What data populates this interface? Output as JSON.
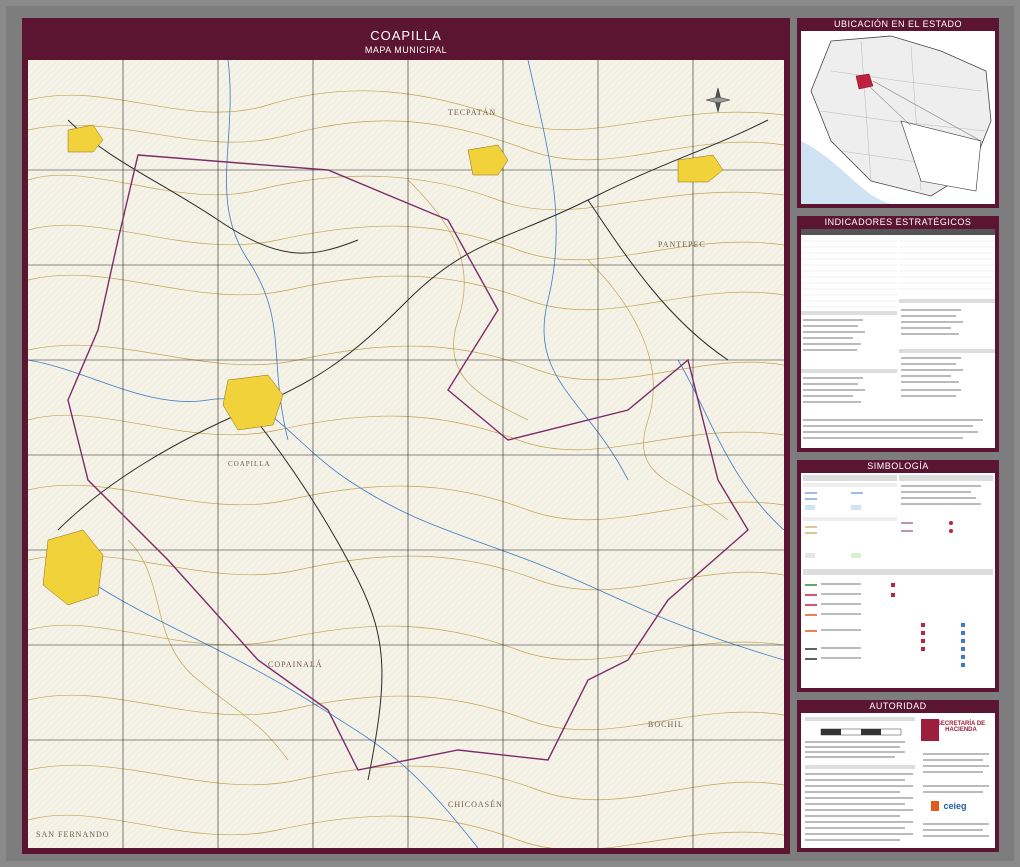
{
  "map": {
    "title": "COAPILLA",
    "subtitle": "MAPA MUNICIPAL",
    "places": [
      "COPAINALÁ",
      "BOCHIL",
      "TECPATÁN",
      "COAPILLA",
      "PANTEPEC",
      "SAN FERNANDO",
      "CHICOASÉN"
    ]
  },
  "panels": {
    "location": {
      "title": "UBICACIÓN EN EL ESTADO"
    },
    "indicators": {
      "title": "INDICADORES ESTRATÉGICOS"
    },
    "symbology": {
      "title": "SIMBOLOGÍA",
      "natural": "RASGOS NATURALES",
      "cultural": "RASGOS CULTURALES",
      "hydro": "HIDROGRAFÍA",
      "infra": "INFRAESTRUCTURA",
      "relief": "RELIEVE"
    },
    "authority": {
      "title": "AUTORIDAD",
      "params": "PARÁMETROS CARTOGRÁFICOS",
      "sources": "FUENTES DE INFORMACIÓN",
      "brand_top": "SECRETARÍA DE HACIENDA",
      "brand_bottom": "ceieg"
    }
  },
  "colors": {
    "frame": "#5b1530",
    "contour": "#b8912f",
    "river": "#3d7ac8",
    "road": "#2a2a2a",
    "boundary": "#7a2d6b",
    "urban": "#f2d23a"
  }
}
